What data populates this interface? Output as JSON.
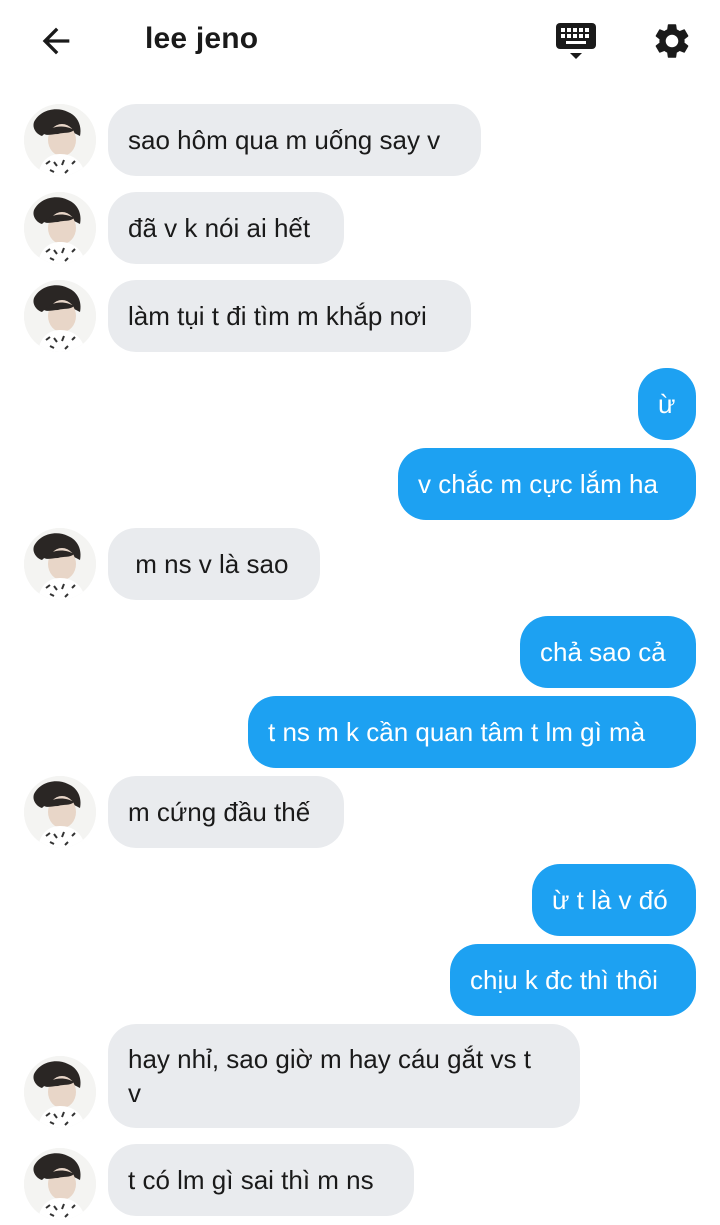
{
  "header": {
    "title": "lee jeno",
    "back_icon": "arrow-left-icon",
    "keyboard_icon": "keyboard-icon",
    "settings_icon": "gear-icon"
  },
  "colors": {
    "incoming_bubble": "#e9ebee",
    "outgoing_bubble": "#1da1f2",
    "text": "#1a1a1a"
  },
  "messages": [
    {
      "side": "in",
      "text": "sao hôm qua m uống say v"
    },
    {
      "side": "in",
      "text": "đã v k nói ai hết"
    },
    {
      "side": "in",
      "text": "làm tụi t đi tìm m khắp nơi"
    },
    {
      "side": "out",
      "text": "ừ"
    },
    {
      "side": "out",
      "text": "v chắc m cực lắm ha"
    },
    {
      "side": "in",
      "text": " m ns v là sao"
    },
    {
      "side": "out",
      "text": "chả sao cả"
    },
    {
      "side": "out",
      "text": "t ns m k cần quan tâm t lm gì mà"
    },
    {
      "side": "in",
      "text": "m cứng đầu thế"
    },
    {
      "side": "out",
      "text": "ừ t là v đó"
    },
    {
      "side": "out",
      "text": "chịu k đc thì thôi"
    },
    {
      "side": "in",
      "text": "hay nhỉ, sao giờ m hay cáu gắt vs t\nv"
    },
    {
      "side": "in",
      "text": "t có lm gì sai thì m ns"
    }
  ]
}
